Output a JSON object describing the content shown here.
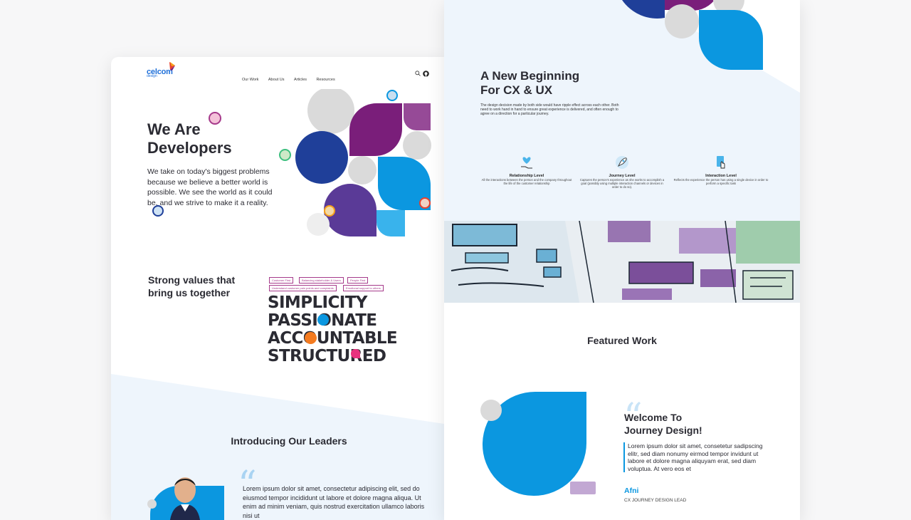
{
  "left": {
    "brand": {
      "name": "celcom",
      "sub": "design"
    },
    "nav": [
      "Our Work",
      "About Us",
      "Articles",
      "Resources"
    ],
    "hero": {
      "title_line1": "We Are",
      "title_line2": "Developers",
      "body": "We take on today's biggest problems because we believe a better world is possible. We see the world as it could be, and we strive to make it a reality."
    },
    "values": {
      "heading_line1": "Strong values that",
      "heading_line2": "bring us together",
      "tags": [
        "Customer First",
        "Balancing stakeholder & Users",
        "People First",
        "Understand customer pain points and complaints",
        "Emotional support to others"
      ],
      "words": [
        "SIMPLICITY",
        "PASSIONATE",
        "ACCOUNTABLE",
        "STRUCTURED"
      ]
    },
    "leaders": {
      "heading": "Introducing Our Leaders",
      "quote": "Lorem ipsum dolor sit amet, consectetur adipiscing elit, sed do eiusmod tempor incididunt ut labore et dolore magna aliqua. Ut enim ad minim veniam, quis nostrud exercitation ullamco laboris nisi ut"
    }
  },
  "right": {
    "beginning": {
      "title_line1": "A New Beginning",
      "title_line2": "For CX & UX",
      "body": "The design decision made by both side would have ripple effect across each other. Both need to work hand in hand to ensure great experience is delivered, and often enough to agree on a direction for a particular journey."
    },
    "levels": [
      {
        "icon": "heart-hand-icon",
        "title": "Relationship Level",
        "desc": "All the interactions between the person and the company throughout the life of the customer relationship"
      },
      {
        "icon": "rocket-icon",
        "title": "Journey Level",
        "desc": "Captures the person's experience as she works to accomplish a goal (possibly using multiple interaction channels or devices in order to do so)."
      },
      {
        "icon": "tap-icon",
        "title": "Interaction Level",
        "desc": "Reflects the experience the person has using a single device in order to perform a specific task"
      }
    ],
    "featured": {
      "heading": "Featured Work",
      "title_line1": "Welcome To",
      "title_line2": "Journey Design!",
      "body": "Lorem ipsum dolor sit amet, consetetur sadipscing elitr, sed diam nonumy eirmod tempor invidunt ut labore et dolore magna aliquyam erat, sed diam voluptua. At vero eos et",
      "author": "Afni",
      "role": "CX JOURNEY DESIGN LEAD"
    }
  },
  "colors": {
    "blue": "#0b97e0",
    "navy": "#1f3f99",
    "purple": "#7a1e7a",
    "violet": "#5a3a97",
    "grey": "#d6d6d6",
    "sky": "#eef5fc"
  }
}
